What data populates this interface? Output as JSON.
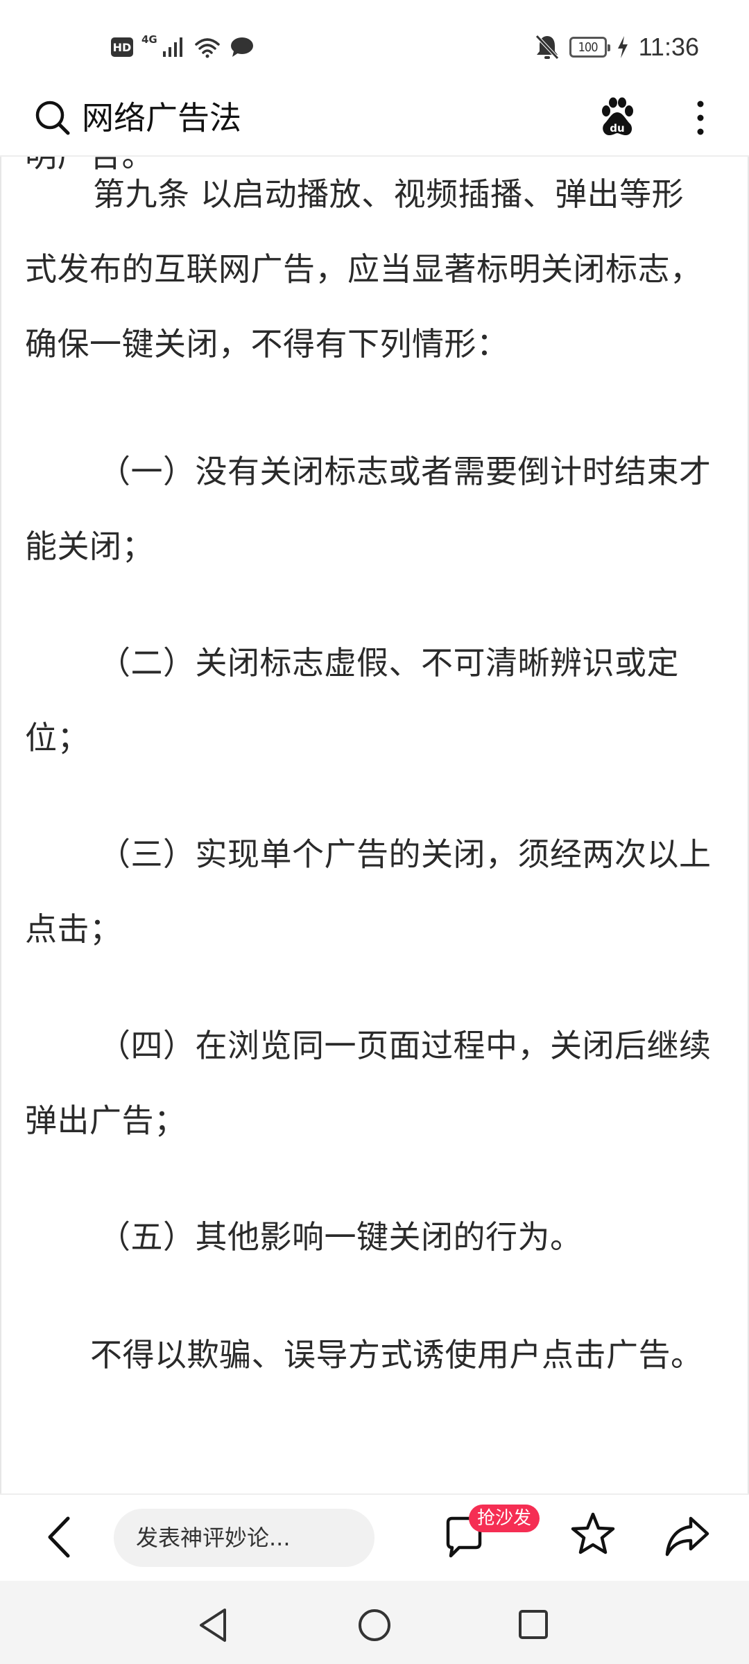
{
  "status_bar": {
    "hd_label": "HD",
    "network_label": "4G",
    "battery_level": "100",
    "time": "11:36",
    "icons": [
      "hd-icon",
      "signal-icon",
      "wifi-icon",
      "message-icon",
      "mute-bell-icon",
      "battery-icon",
      "charging-icon"
    ]
  },
  "header": {
    "search_query": "网络广告法",
    "icons": [
      "search-icon",
      "baidu-paw-icon",
      "more-vertical-icon"
    ]
  },
  "article": {
    "paragraphs": [
      "明广告。",
      "第九条  以启动播放、视频插播、弹出等形",
      "式发布的互联网广告，应当显著标明关闭标志，",
      "确保一键关闭，不得有下列情形：",
      "（一）没有关闭标志或者需要倒计时结束才",
      "能关闭；",
      "（二）关闭标志虚假、不可清晰辨识或定",
      "位；",
      "（三）实现单个广告的关闭，须经两次以上",
      "点击；",
      "（四）在浏览同一页面过程中，关闭后继续",
      "弹出广告；",
      "（五）其他影响一键关闭的行为。",
      "不得以欺骗、误导方式诱使用户点击广告。"
    ]
  },
  "toolbar": {
    "comment_placeholder": "发表神评妙论...",
    "sofa_badge": "抢沙发",
    "icons": [
      "back-arrow-icon",
      "comment-icon",
      "star-icon",
      "share-icon"
    ]
  },
  "nav_bar": {
    "icons": [
      "nav-back-icon",
      "nav-home-icon",
      "nav-recent-icon"
    ]
  },
  "colors": {
    "accent_badge": "#f52e53",
    "text": "#2a2a2a",
    "nav_bg": "#f4f4f4"
  }
}
